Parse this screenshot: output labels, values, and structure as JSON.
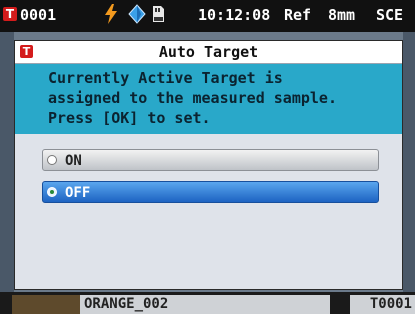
{
  "statusbar": {
    "badge": "T",
    "sample_no": "0001",
    "clock": "10:12:08",
    "ref": "Ref",
    "area": "8mm",
    "mode": "SCE",
    "icons": [
      "lightning-icon",
      "diamond-icon",
      "sd-card-icon"
    ]
  },
  "dialog": {
    "icon_letter": "T",
    "title": "Auto Target",
    "message_lines": [
      "Currently Active Target is",
      "assigned to the measured sample.",
      "Press [OK] to set."
    ],
    "options": [
      {
        "label": "ON",
        "selected": false
      },
      {
        "label": "OFF",
        "selected": true
      }
    ]
  },
  "bottombar": {
    "sample_name": "ORANGE_002",
    "target_no": "T0001"
  },
  "colors": {
    "message_bg": "#29a8c9",
    "selected_option": "#2b7fd6",
    "badge": "#d41b1b"
  }
}
